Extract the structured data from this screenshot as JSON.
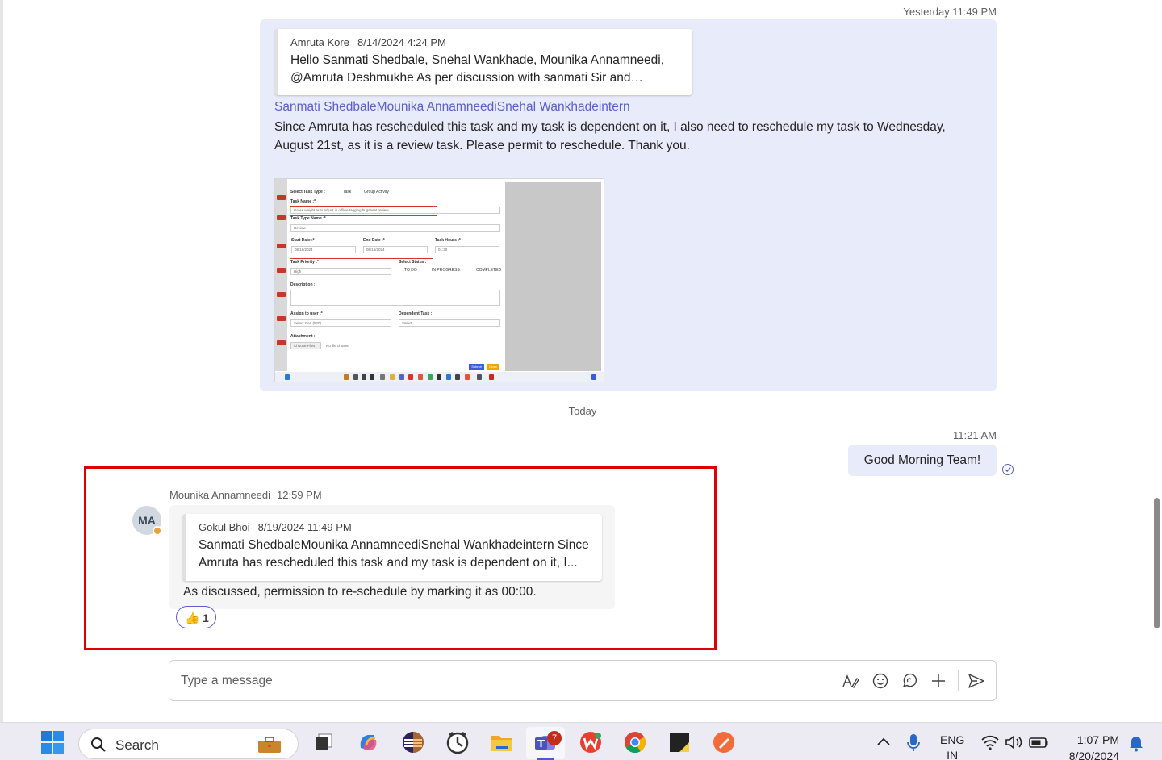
{
  "timestamps": {
    "yesterday": "Yesterday 11:49 PM",
    "today_divider": "Today",
    "good_morning_time": "11:21 AM"
  },
  "outgoing_message": {
    "quote": {
      "author": "Amruta Kore",
      "time": "8/14/2024 4:24 PM",
      "text": "Hello Sanmati Shedbale, Snehal Wankhade, Mounika Annamneedi, @Amruta Deshmukhe As per discussion with sanmati Sir and Snehal..."
    },
    "mentions": "Sanmati ShedbaleMounika AnnamneediSnehal Wankhadeintern",
    "body": "Since Amruta has rescheduled this task and my task is dependent on it, I also need to reschedule my task to Wednesday, August 21st, as it is a review task. Please permit to reschedule. Thank you.",
    "embedded_screenshot": {
      "select_task_type": "Select Task Type :",
      "opt_task": "Task",
      "opt_group": "Group Activity",
      "task_name_label": "Task Name :*",
      "task_name_value": "Gross weight auto adjust in offline tagging bugsheet review",
      "task_type_label": "Task Type Name :*",
      "task_type_value": "Review",
      "start_label": "Start Date :*",
      "start_value": "08/16/2024",
      "end_label": "End Date :*",
      "end_value": "08/16/2024",
      "hours_label": "Task Hours :*",
      "hours_value": "01:30",
      "priority_label": "Task Priority :*",
      "priority_value": "High",
      "status_label": "Select Status :",
      "status_todo": "TO DO",
      "status_inprogress": "IN PROGRESS",
      "status_completed": "COMPLETED",
      "description_label": "Description :",
      "assign_label": "Assign to user :*",
      "assign_value": "Select Gen (520)",
      "dependent_label": "Dependent Task :",
      "dependent_value": "Select...",
      "attachment_label": "Attachment :",
      "choose_files": "Choose Files",
      "no_file": "No file chosen",
      "submit": "Submit",
      "close": "Close"
    }
  },
  "good_morning": {
    "text": "Good Morning Team!"
  },
  "incoming_message": {
    "avatar_initials": "MA",
    "author": "Mounika Annamneedi",
    "time": "12:59 PM",
    "quote": {
      "author": "Gokul Bhoi",
      "time": "8/19/2024 11:49 PM",
      "text": "Sanmati ShedbaleMounika AnnamneediSnehal Wankhadeintern Since Amruta has rescheduled this task and my task is dependent on it, I..."
    },
    "body": "As discussed, permission to re-schedule by marking it as 00:00.",
    "reaction": {
      "emoji": "👍",
      "count": "1"
    }
  },
  "compose": {
    "placeholder": "Type a message"
  },
  "taskbar": {
    "search_label": "Search",
    "teams_badge": "7",
    "lang_line1": "ENG",
    "lang_line2": "IN",
    "time": "1:07 PM",
    "date": "8/20/2024"
  },
  "colors": {
    "accent": "#5b5fc7",
    "bubble_out": "#e8ebfa",
    "bubble_in": "#f5f5f5",
    "highlight": "#e00000"
  }
}
